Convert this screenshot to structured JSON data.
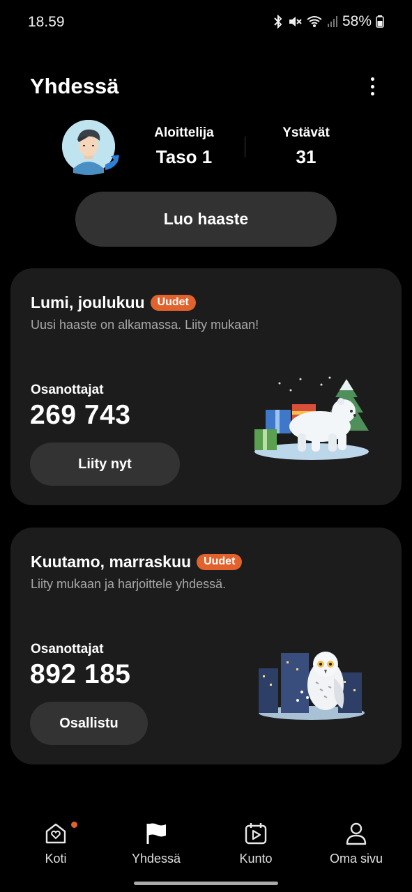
{
  "status_bar": {
    "time": "18.59",
    "battery": "58%",
    "icons": [
      "bluetooth-icon",
      "mute-icon",
      "wifi-icon",
      "signal-icon",
      "battery-icon"
    ]
  },
  "header": {
    "title": "Yhdessä",
    "more_icon": "more-vertical-icon"
  },
  "profile": {
    "level_label": "Aloittelija",
    "level_value": "Taso 1",
    "friends_label": "Ystävät",
    "friends_value": "31"
  },
  "create_challenge_label": "Luo haaste",
  "challenges": [
    {
      "title": "Lumi, joulukuu",
      "badge": "Uudet",
      "subtitle": "Uusi haaste on alkamassa. Liity mukaan!",
      "participants_label": "Osanottajat",
      "participants_count": "269 743",
      "button_label": "Liity nyt",
      "illustration": "polar-bear-illustration"
    },
    {
      "title": "Kuutamo, marraskuu",
      "badge": "Uudet",
      "subtitle": "Liity mukaan ja harjoittele yhdessä.",
      "participants_label": "Osanottajat",
      "participants_count": "892 185",
      "button_label": "Osallistu",
      "illustration": "snowy-owl-illustration"
    }
  ],
  "bottom_nav": [
    {
      "label": "Koti",
      "icon": "home-heart-icon",
      "has_dot": true
    },
    {
      "label": "Yhdessä",
      "icon": "flag-icon",
      "active": true
    },
    {
      "label": "Kunto",
      "icon": "play-calendar-icon"
    },
    {
      "label": "Oma sivu",
      "icon": "person-icon"
    }
  ],
  "colors": {
    "accent": "#e1622d",
    "card_bg": "#1c1c1c",
    "button_bg": "#333333"
  }
}
